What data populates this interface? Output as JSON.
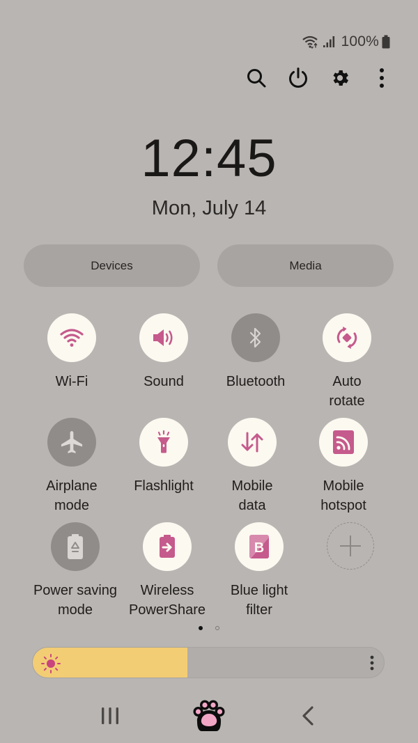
{
  "status_bar": {
    "wifi_icon": "wifi-data-icon",
    "signal_icon": "cell-signal-icon",
    "battery_percent": "100%",
    "battery_icon": "battery-full-icon"
  },
  "toolbar": {
    "search_icon": "search-icon",
    "power_icon": "power-icon",
    "settings_icon": "gear-icon",
    "more_icon": "more-vertical-icon"
  },
  "clock": {
    "time": "12:45",
    "date": "Mon, July 14"
  },
  "pills": {
    "devices": "Devices",
    "media": "Media"
  },
  "tiles": [
    {
      "label": "Wi-Fi",
      "state": "on",
      "icon": "wifi-icon"
    },
    {
      "label": "Sound",
      "state": "on",
      "icon": "speaker-icon"
    },
    {
      "label": "Bluetooth",
      "state": "off",
      "icon": "bluetooth-icon"
    },
    {
      "label": "Auto rotate",
      "line1": "Auto",
      "line2": "rotate",
      "state": "on",
      "icon": "auto-rotate-icon"
    },
    {
      "label": "Airplane mode",
      "line1": "Airplane",
      "line2": "mode",
      "state": "off",
      "icon": "airplane-icon"
    },
    {
      "label": "Flashlight",
      "state": "on",
      "icon": "flashlight-icon"
    },
    {
      "label": "Mobile data",
      "line1": "Mobile",
      "line2": "data",
      "state": "on",
      "icon": "mobile-data-icon"
    },
    {
      "label": "Mobile hotspot",
      "line1": "Mobile",
      "line2": "hotspot",
      "state": "on",
      "icon": "hotspot-icon"
    },
    {
      "label": "Power saving mode",
      "line1": "Power saving",
      "line2": "mode",
      "state": "off",
      "icon": "power-saving-icon"
    },
    {
      "label": "Wireless PowerShare",
      "line1": "Wireless",
      "line2": "PowerShare",
      "state": "on",
      "icon": "wireless-powershare-icon"
    },
    {
      "label": "Blue light filter",
      "line1": "Blue light",
      "line2": "filter",
      "state": "on",
      "icon": "blue-light-filter-icon"
    },
    {
      "label": "",
      "state": "add",
      "icon": "add-icon"
    }
  ],
  "pager": {
    "current_page": 1,
    "total_pages": 2
  },
  "brightness": {
    "level": 0.44,
    "icon": "sun-icon",
    "more_icon": "more-vertical-icon"
  },
  "navbar": {
    "recents_icon": "recents-icon",
    "home_icon": "paw-home-icon",
    "back_icon": "back-icon"
  },
  "colors": {
    "background": "#b9b5b2",
    "accent": "#c55a8c",
    "tile_on": "#fcf9f1",
    "tile_off": "#8f8c8a",
    "brightness_fill": "#f3cd74",
    "paw_pink": "#f2a6c6"
  }
}
